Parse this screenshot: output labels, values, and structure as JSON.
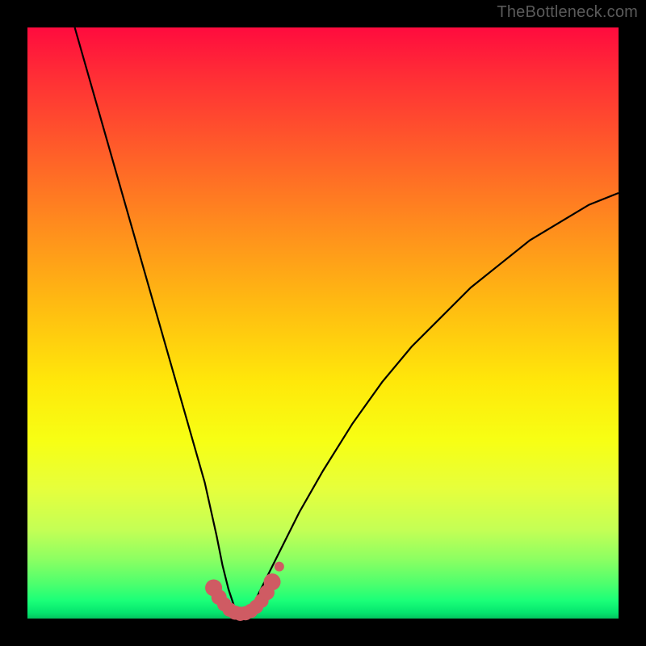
{
  "watermark": "TheBottleneck.com",
  "colors": {
    "background": "#000000",
    "gradient_top": "#ff0b3e",
    "gradient_mid": "#ffe80a",
    "gradient_bottom": "#04c45e",
    "curve": "#000000",
    "dots": "#cf5b63"
  },
  "chart_data": {
    "type": "line",
    "title": "",
    "xlabel": "",
    "ylabel": "",
    "xlim": [
      0,
      100
    ],
    "ylim": [
      0,
      100
    ],
    "grid": false,
    "legend": false,
    "description": "V-shaped bottleneck curve overlaid on a red-to-green vertical heatmap. Lower y = better match (green). Minimum around x≈36.",
    "series": [
      {
        "name": "bottleneck-curve",
        "x": [
          8,
          10,
          12,
          14,
          16,
          18,
          20,
          22,
          24,
          26,
          28,
          30,
          32,
          33,
          34,
          35,
          36,
          37,
          38,
          39,
          40,
          42,
          44,
          46,
          50,
          55,
          60,
          65,
          70,
          75,
          80,
          85,
          90,
          95,
          100
        ],
        "y": [
          100,
          93,
          86,
          79,
          72,
          65,
          58,
          51,
          44,
          37,
          30,
          23,
          14,
          9,
          5,
          2,
          1,
          1,
          2,
          4,
          6,
          10,
          14,
          18,
          25,
          33,
          40,
          46,
          51,
          56,
          60,
          64,
          67,
          70,
          72
        ]
      }
    ],
    "highlight_points": {
      "name": "optimal-range-dots",
      "x": [
        31.5,
        32.4,
        33.3,
        34.2,
        35.1,
        36.0,
        36.9,
        37.8,
        38.7,
        39.6,
        40.5,
        41.4
      ],
      "y": [
        5.2,
        3.6,
        2.4,
        1.5,
        1.0,
        0.8,
        0.9,
        1.3,
        2.0,
        3.0,
        4.4,
        6.2
      ]
    }
  }
}
